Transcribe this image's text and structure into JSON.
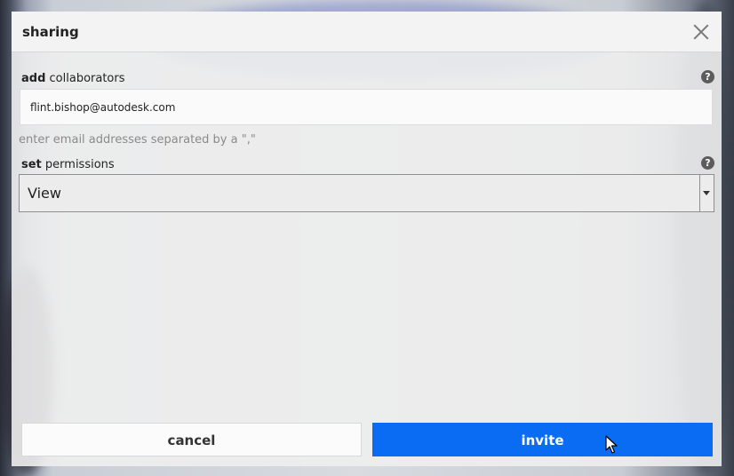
{
  "dialog": {
    "title": "sharing",
    "close_icon": "close-icon"
  },
  "collaborators": {
    "label_bold": "add",
    "label_rest": " collaborators",
    "help_glyph": "?",
    "email_value": "flint.bishop@autodesk.com",
    "hint": "enter email addresses separated by a \",\""
  },
  "permissions": {
    "label_bold": "set",
    "label_rest": " permissions",
    "help_glyph": "?",
    "selected": "View"
  },
  "actions": {
    "cancel_label": "cancel",
    "invite_label": "invite"
  },
  "colors": {
    "accent": "#0a6cf2",
    "panel": "#eeeeee"
  }
}
